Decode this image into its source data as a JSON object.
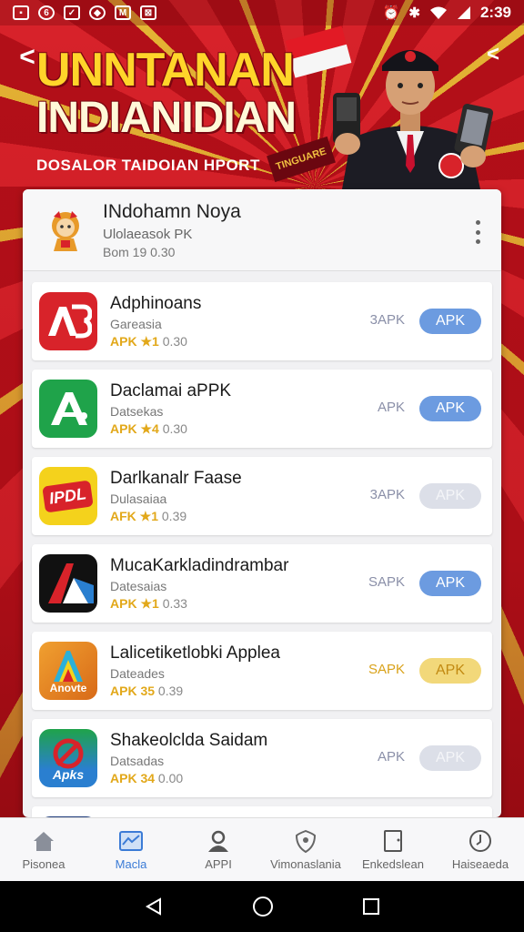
{
  "status": {
    "time": "2:39",
    "left_icons": [
      "image-icon",
      "whatsapp-icon",
      "mail-icon",
      "vpn-icon",
      "news-icon",
      "gallery-icon"
    ],
    "right_icons": [
      "alarm-icon",
      "bluetooth-icon",
      "wifi-icon",
      "signal-icon"
    ]
  },
  "hero": {
    "title_line1": "UNNTANAN",
    "title_line2": "INDIANIDIAN",
    "subtitle": "DOSALOR TAIDOIAN HPORT",
    "sash_text": "TINGUARE"
  },
  "header": {
    "title": "INdohamn Noya",
    "subtitle": "Ulolaeasok PK",
    "meta": "Bom 19 0.30"
  },
  "apps": [
    {
      "name": "Adphinoans",
      "category": "Gareasia",
      "meta_prefix": "APK ★1",
      "meta_num": "0.30",
      "apk_label": "3APK",
      "button": "APK",
      "icon_text": "AB",
      "icon_bg": "#d8232a",
      "button_color": "#6c9be0"
    },
    {
      "name": "Daclamai aPPK",
      "category": "Datsekas",
      "meta_prefix": "APK ★4",
      "meta_num": "0.30",
      "apk_label": "APK",
      "button": "APK",
      "icon_text": "A",
      "icon_bg": "#1fa34a",
      "button_color": "#6c9be0"
    },
    {
      "name": "Darlkanalr Faase",
      "category": "Dulasaiaa",
      "meta_prefix": "AFK ★1",
      "meta_num": "0.39",
      "apk_label": "3APK",
      "button": "APK",
      "icon_text": "IPDL",
      "icon_bg": "#f4d21c",
      "button_color": "#dcdfe8"
    },
    {
      "name": "MucaKarkladindrambar",
      "category": "Datesaias",
      "meta_prefix": "APK ★1",
      "meta_num": "0.33",
      "apk_label": "SAPK",
      "button": "APK",
      "icon_text": "A",
      "icon_bg": "#111111",
      "button_color": "#6c9be0"
    },
    {
      "name": "Lalicetiketlobki Applea",
      "category": "Dateades",
      "meta_prefix": "APK 35",
      "meta_num": "0.39",
      "apk_label": "SAPK",
      "button": "APK",
      "icon_text": "A",
      "icon_bg": "#e68a1e",
      "button_color": "#f2d87a",
      "icon_mini": "Anovte"
    },
    {
      "name": "Shakeolclda Saidam",
      "category": "Datsadas",
      "meta_prefix": "APK 34",
      "meta_num": "0.00",
      "apk_label": "APK",
      "button": "APK",
      "icon_text": "",
      "icon_bg": "#2a7fd0",
      "button_color": "#dcdfe8",
      "icon_mini": "Apks"
    }
  ],
  "nav": [
    {
      "label": "Pisonea",
      "icon": "home-icon"
    },
    {
      "label": "Macla",
      "icon": "chart-icon"
    },
    {
      "label": "APPI",
      "icon": "profile-icon"
    },
    {
      "label": "Vimonaslania",
      "icon": "shield-icon"
    },
    {
      "label": "Enkedslean",
      "icon": "tablet-icon"
    },
    {
      "label": "Haiseaeda",
      "icon": "clock-icon"
    }
  ],
  "colors": {
    "accent": "#3b7bd6",
    "hero_title": "#ffd52a",
    "background": "#c0141c"
  }
}
